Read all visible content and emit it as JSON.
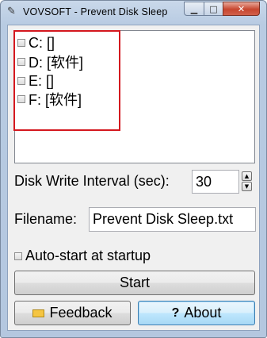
{
  "window": {
    "title": "VOVSOFT - Prevent Disk Sleep",
    "app_icon_glyph": "✎",
    "min_glyph": "▁",
    "max_glyph": "□",
    "close_glyph": "✕"
  },
  "drives": [
    {
      "label": "C: []",
      "checked": false
    },
    {
      "label": "D: [软件]",
      "checked": false
    },
    {
      "label": "E: []",
      "checked": false
    },
    {
      "label": "F: [软件]",
      "checked": false
    }
  ],
  "interval": {
    "label": "Disk Write Interval (sec):",
    "value": "30",
    "up_glyph": "▲",
    "down_glyph": "▼"
  },
  "filename": {
    "label": "Filename:",
    "value": "Prevent Disk Sleep.txt"
  },
  "autostart": {
    "label": "Auto-start at startup",
    "checked": false
  },
  "buttons": {
    "start": "Start",
    "feedback": "Feedback",
    "about": "About",
    "about_icon_glyph": "?"
  },
  "colors": {
    "highlight": "#d4181f",
    "focus_border": "#3c7fb1"
  }
}
